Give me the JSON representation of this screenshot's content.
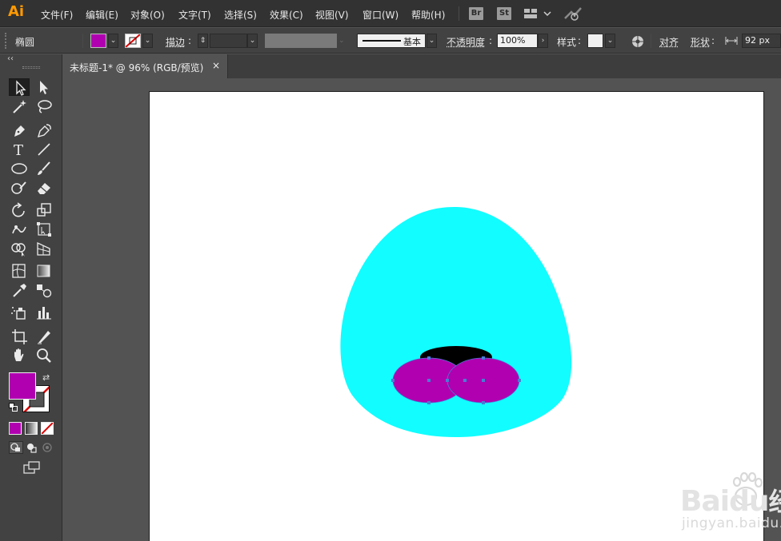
{
  "app": {
    "logo": "Ai",
    "menu": [
      "文件(F)",
      "编辑(E)",
      "对象(O)",
      "文字(T)",
      "选择(S)",
      "效果(C)",
      "视图(V)",
      "窗口(W)",
      "帮助(H)"
    ],
    "bridge_badge": "Br",
    "stock_badge": "St"
  },
  "control_bar": {
    "object_type": "椭圆",
    "fill_color": "#b000b0",
    "stroke_label": "描边",
    "colon": ":",
    "stroke_style_label": "基本",
    "opacity_label": "不透明度",
    "opacity_value": "100%",
    "style_label": "样式",
    "align_label": "对齐",
    "shape_label": "形状",
    "width_value": "92 px"
  },
  "document_tab": {
    "title": "未标题-1* @ 96% (RGB/预览)",
    "close_glyph": "×"
  },
  "tools_panel": {
    "collapse_glyph": "‹‹",
    "fill_color": "#b000b0",
    "stroke_color": "none"
  },
  "artwork": {
    "head_color": "#12fdff",
    "nose_color": "#000000",
    "cheek_color": "#b000b0",
    "selection_color": "#4a7bd6"
  },
  "watermark": {
    "brand": "Baidu",
    "brand_cn": "经验",
    "url": "jingyan.baidu.com"
  }
}
